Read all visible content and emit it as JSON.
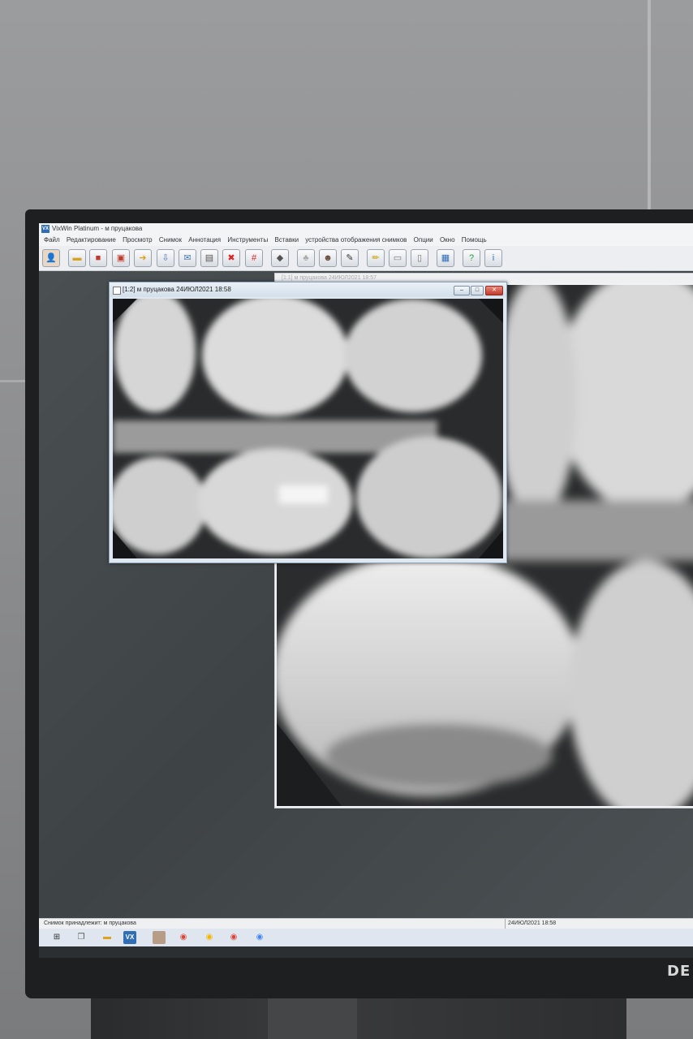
{
  "app": {
    "title": "VixWin Platinum - м пруцакова",
    "app_icon_text": "VX"
  },
  "menu": [
    "Файл",
    "Редактирование",
    "Просмотр",
    "Снимок",
    "Аннотация",
    "Инструменты",
    "Вставки",
    "устройства отображения снимков",
    "Опции",
    "Окно",
    "Помощь"
  ],
  "toolbar": {
    "icons": [
      "patient-icon",
      "open-folder-icon",
      "save-icon",
      "copy-images-icon",
      "export-icon",
      "import-icon",
      "email-icon",
      "print-icon",
      "delete-icon",
      "grid-icon",
      "acquire-icon",
      "teeth-icon",
      "face-icon",
      "pen-icon",
      "highlight-icon",
      "ruler-icon",
      "document-icon",
      "layout-icon",
      "help-icon",
      "info-icon"
    ]
  },
  "windows": {
    "back_title": "[1:1] м пруцакова 24ИЮЛ2021 18:57",
    "front_title": "[1:2] м пруцакова 24ИЮЛ2021 18:58",
    "front_buttons": {
      "minimize": "–",
      "maximize": "□",
      "close": "✕"
    }
  },
  "statusbar": {
    "owner": "Снимок принадлежит: м пруцакова",
    "datetime": "24ИЮЛ2021 18:58"
  },
  "taskbar": {
    "items": [
      "start-icon",
      "task-view-icon",
      "file-explorer-icon",
      "vixwin-icon",
      "photo-app-icon",
      "chrome-icon",
      "chrome-profile-2-icon",
      "chrome-profile-3-icon",
      "chrome-profile-4-icon"
    ],
    "vixwin_label": "VX"
  },
  "monitor": {
    "brand": "DE"
  },
  "colors": {
    "accent": "#2f6db5",
    "close": "#c0392b",
    "screen_bg": "#3f4446"
  }
}
